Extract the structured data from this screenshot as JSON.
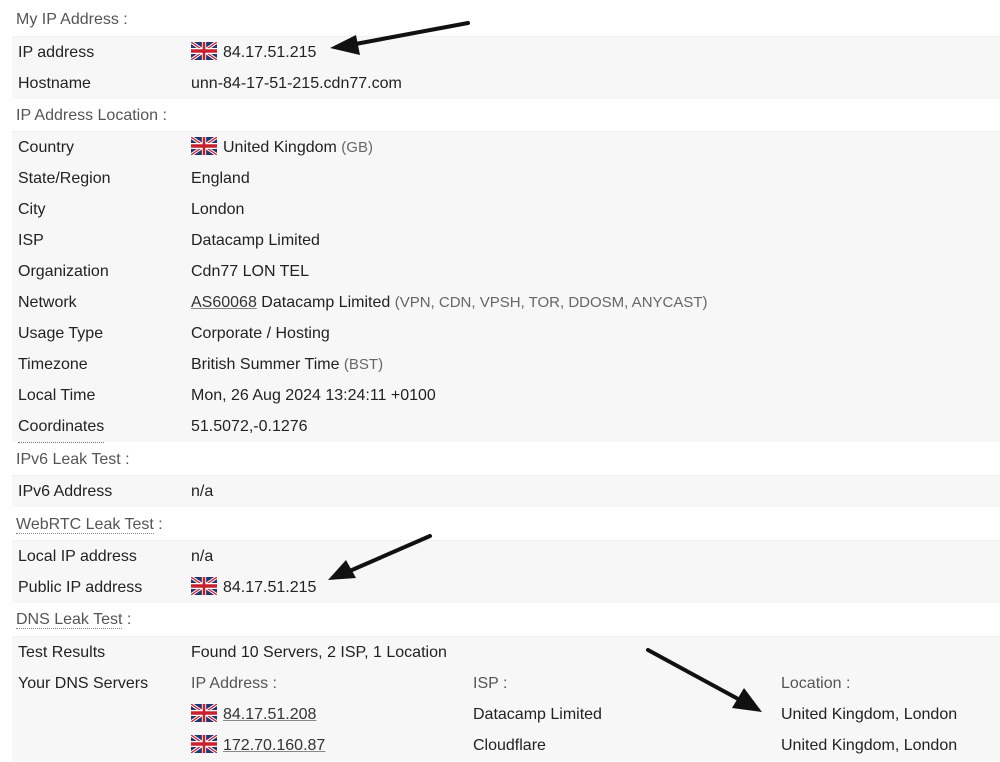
{
  "my_ip": {
    "title": "My IP Address :",
    "ip_label": "IP address",
    "ip_value": "84.17.51.215",
    "hostname_label": "Hostname",
    "hostname_value": "unn-84-17-51-215.cdn77.com"
  },
  "location": {
    "title": "IP Address Location :",
    "country_label": "Country",
    "country_value": "United Kingdom",
    "country_code": "(GB)",
    "state_label": "State/Region",
    "state_value": "England",
    "city_label": "City",
    "city_value": "London",
    "isp_label": "ISP",
    "isp_value": "Datacamp Limited",
    "org_label": "Organization",
    "org_value": "Cdn77 LON TEL",
    "network_label": "Network",
    "network_as": "AS60068",
    "network_name": "Datacamp Limited",
    "network_tags": "(VPN, CDN, VPSH, TOR, DDOSM, ANYCAST)",
    "usage_label": "Usage Type",
    "usage_value": "Corporate / Hosting",
    "tz_label": "Timezone",
    "tz_value": "British Summer Time",
    "tz_code": "(BST)",
    "localtime_label": "Local Time",
    "localtime_value": "Mon, 26 Aug 2024 13:24:11 +0100",
    "coords_label": "Coordinates",
    "coords_value": "51.5072,-0.1276"
  },
  "ipv6": {
    "title": "IPv6 Leak Test :",
    "addr_label": "IPv6 Address",
    "addr_value": "n/a"
  },
  "webrtc": {
    "title": "WebRTC Leak Test",
    "title_suffix": " :",
    "local_label": "Local IP address",
    "local_value": "n/a",
    "public_label": "Public IP address",
    "public_value": "84.17.51.215"
  },
  "dns": {
    "title": "DNS Leak Test",
    "title_suffix": " :",
    "results_label": "Test Results",
    "results_value": "Found 10 Servers, 2 ISP, 1 Location",
    "servers_label": "Your DNS Servers",
    "col_ip": "IP Address :",
    "col_isp": "ISP :",
    "col_location": "Location :",
    "servers": [
      {
        "ip": "84.17.51.208",
        "isp": "Datacamp Limited",
        "location": "United Kingdom, London"
      },
      {
        "ip": "172.70.160.87",
        "isp": "Cloudflare",
        "location": "United Kingdom, London"
      }
    ]
  },
  "icons": {
    "flag": "uk-flag-icon",
    "arrow": "black-arrow-annotation"
  },
  "colors": {
    "row_bg": "#f7f7f7",
    "title": "#555555",
    "text": "#222222"
  }
}
